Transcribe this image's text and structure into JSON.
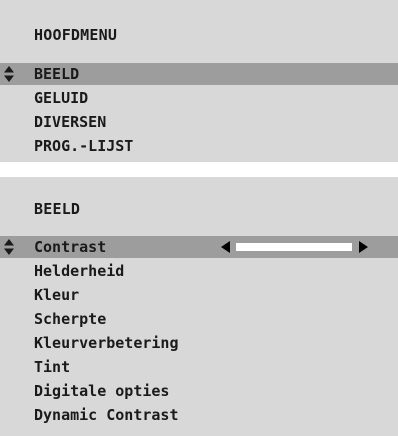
{
  "main_menu": {
    "title": "HOOFDMENU",
    "items": [
      {
        "label": "BEELD",
        "selected": true
      },
      {
        "label": "GELUID",
        "selected": false
      },
      {
        "label": "DIVERSEN",
        "selected": false
      },
      {
        "label": "PROG.-LIJST",
        "selected": false
      }
    ]
  },
  "beeld_menu": {
    "title": "BEELD",
    "items": [
      {
        "label": "Contrast",
        "selected": true,
        "slider_level_percent": 100
      },
      {
        "label": "Helderheid",
        "selected": false
      },
      {
        "label": "Kleur",
        "selected": false
      },
      {
        "label": "Scherpte",
        "selected": false
      },
      {
        "label": "Kleurverbetering",
        "selected": false
      },
      {
        "label": "Tint",
        "selected": false
      },
      {
        "label": "Digitale opties",
        "selected": false
      },
      {
        "label": "Dynamic Contrast",
        "selected": false
      }
    ]
  },
  "icons": {
    "selection_marker": "up-down-arrow-icon",
    "slider_decrease": "triangle-left-icon",
    "slider_increase": "triangle-right-icon"
  },
  "colors": {
    "panel_background": "#d8d8d8",
    "selected_row": "#9d9d9d",
    "text": "#1a1a1a",
    "slider_bar": "#ffffff"
  }
}
